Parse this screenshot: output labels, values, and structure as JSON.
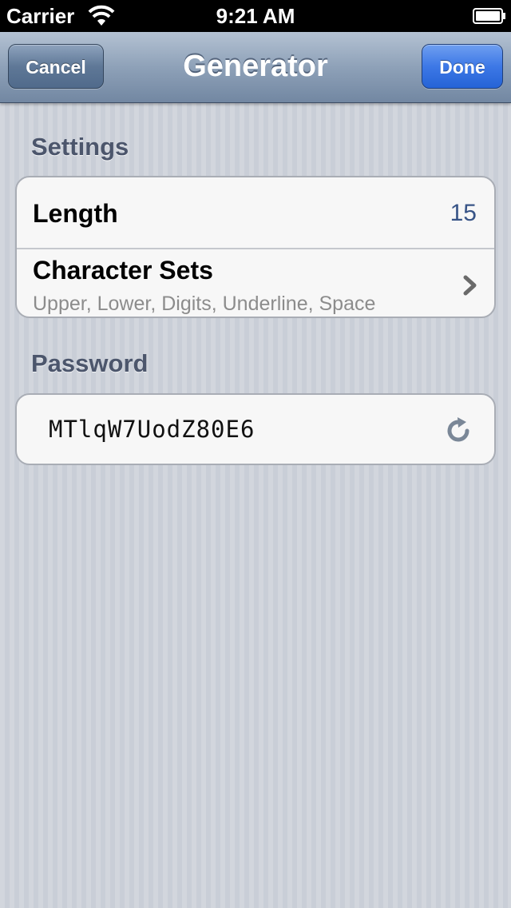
{
  "status_bar": {
    "carrier": "Carrier",
    "time": "9:21 AM",
    "wifi_icon": "wifi-icon",
    "battery_icon": "battery-icon"
  },
  "nav": {
    "title": "Generator",
    "cancel_label": "Cancel",
    "done_label": "Done",
    "done_color": "#2f6fe0",
    "bar_color": "#8ea1b8"
  },
  "settings": {
    "header": "Settings",
    "length_label": "Length",
    "length_value": "15",
    "charsets_label": "Character Sets",
    "charsets_value": "Upper, Lower, Digits, Underline, Space",
    "chevron_icon": "chevron-right-icon"
  },
  "password": {
    "header": "Password",
    "value": "MTlqW7UodZ80E6",
    "refresh_icon": "refresh-icon"
  }
}
